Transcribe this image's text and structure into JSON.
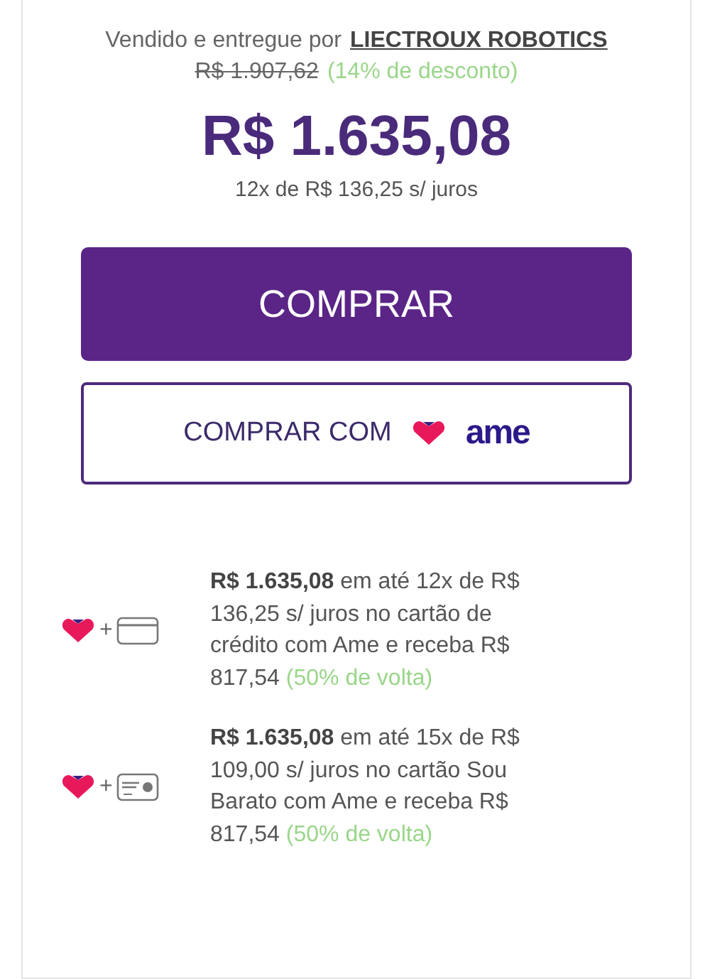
{
  "seller": {
    "label": "Vendido e entregue por",
    "name": "LIECTROUX ROBOTICS"
  },
  "old_price": "R$ 1.907,62",
  "discount": "(14% de desconto)",
  "price": "R$ 1.635,08",
  "installments": "12x de R$ 136,25 s/ juros",
  "buy_button": "COMPRAR",
  "ame_button": {
    "label": "COMPRAR COM",
    "logo_text": "ame"
  },
  "offers": [
    {
      "kind": "credit-card",
      "plus": "+",
      "text": "**R$ 1.635,08** em até 12x de R$ 136,25 s/ juros no cartão de crédito com Ame e receba R$ 817,54",
      "cashback": "(50% de volta)"
    },
    {
      "kind": "store-card",
      "plus": "+",
      "text": "**R$ 1.635,08** em até 15x de R$ 109,00 s/ juros no cartão Sou Barato com Ame e receba R$ 817,54",
      "cashback": "(50% de volta)"
    }
  ]
}
